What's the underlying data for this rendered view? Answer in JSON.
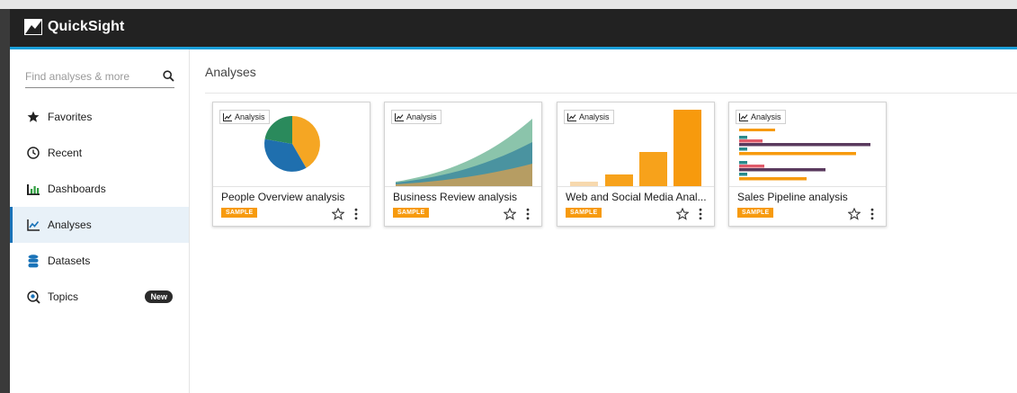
{
  "app": {
    "name": "QuickSight"
  },
  "search": {
    "placeholder": "Find analyses & more"
  },
  "sidebar": {
    "items": [
      {
        "label": "Favorites",
        "icon": "star-icon"
      },
      {
        "label": "Recent",
        "icon": "clock-icon"
      },
      {
        "label": "Dashboards",
        "icon": "dashboard-icon"
      },
      {
        "label": "Analyses",
        "icon": "analysis-icon",
        "active": true
      },
      {
        "label": "Datasets",
        "icon": "database-icon"
      },
      {
        "label": "Topics",
        "icon": "topics-icon",
        "badge": "New"
      }
    ]
  },
  "main": {
    "title": "Analyses",
    "cards": [
      {
        "chip": "Analysis",
        "title": "People Overview analysis",
        "badge": "SAMPLE",
        "thumbnail": "pie"
      },
      {
        "chip": "Analysis",
        "title": "Business Review analysis",
        "badge": "SAMPLE",
        "thumbnail": "area"
      },
      {
        "chip": "Analysis",
        "title": "Web and Social Media Anal...",
        "badge": "SAMPLE",
        "thumbnail": "bar"
      },
      {
        "chip": "Analysis",
        "title": "Sales Pipeline analysis",
        "badge": "SAMPLE",
        "thumbnail": "horizontal-bar"
      }
    ]
  },
  "colors": {
    "header": "#222222",
    "accent": "#1a9fd9",
    "active_nav": "#e8f1f8",
    "sample_badge": "#f79a0d"
  }
}
